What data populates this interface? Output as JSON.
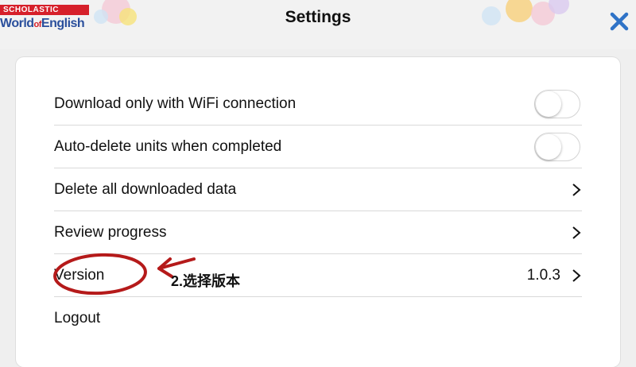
{
  "header": {
    "logo_brand": "SCHOLASTIC",
    "logo_word1": "World",
    "logo_of": "of",
    "logo_word2": "English",
    "title": "Settings"
  },
  "settings": [
    {
      "label": "Download only with WiFi connection",
      "control": "toggle",
      "on": false
    },
    {
      "label": "Auto-delete units when completed",
      "control": "toggle",
      "on": false
    },
    {
      "label": "Delete all downloaded data",
      "control": "chevron"
    },
    {
      "label": "Review progress",
      "control": "chevron"
    },
    {
      "label": "Version",
      "control": "chevron",
      "value": "1.0.3"
    },
    {
      "label": "Logout",
      "control": "none"
    }
  ],
  "annotation": {
    "text": "2.选择版本",
    "color": "#b51a1a"
  },
  "colors": {
    "close_icon": "#2f73c7",
    "brand_red": "#d6202a",
    "brand_blue": "#2a4f9c"
  }
}
